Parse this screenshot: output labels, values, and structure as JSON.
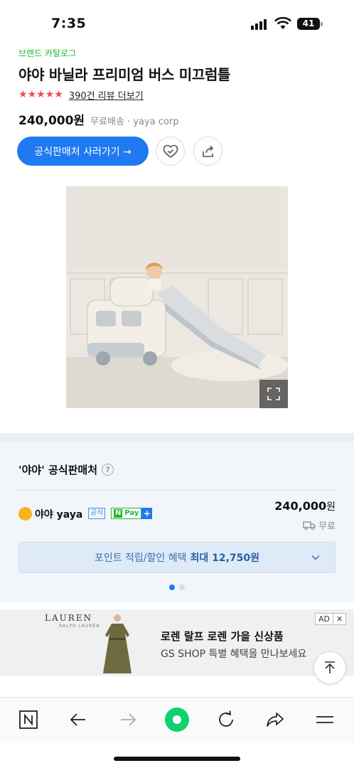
{
  "status_bar": {
    "time": "7:35",
    "battery": "41"
  },
  "product": {
    "brand_link": "브랜드 카탈로그",
    "title": "야야 바닐라 프리미엄 버스 미끄럼틀",
    "rating_stars": 5,
    "review_link": "390건 리뷰 더보기",
    "price": "240,000원",
    "shipping_info": "무료배송 · yaya corp",
    "buy_button": "공식판매처 사러가기 →"
  },
  "icons": {
    "wishlist": "heart-check-icon",
    "share": "share-icon",
    "expand": "expand-icon"
  },
  "seller_section": {
    "heading": "'야야' 공식판매처",
    "help": "?",
    "seller_name": "야야 yaya",
    "badge_official": "공식",
    "badge_npay_n": "N",
    "badge_npay": "Pay",
    "badge_npay_plus": "+",
    "price_number": "240,000",
    "price_unit": "원",
    "shipping": "무료",
    "benefit_text": "포인트 적립/할인 혜택",
    "benefit_highlight": "최대 12,750원",
    "pager_total": 2,
    "pager_active": 1
  },
  "ad": {
    "brand": "LAUREN",
    "brand_sub": "RALPH LAUREN",
    "title": "로렌 랄프 로렌 가을 신상품",
    "subtitle": "GS SHOP 특별 혜택을 만나보세요",
    "ad_label": "AD",
    "close_label": "✕"
  },
  "colors": {
    "brand_green": "#1fb830",
    "primary_blue": "#1f7af1",
    "star_red": "#f04a4a",
    "section_bg": "#f2f6fa"
  },
  "bottom_nav": [
    "naver-icon",
    "back-arrow-icon",
    "forward-arrow-icon",
    "green-dot-icon",
    "reload-icon",
    "share-arrow-icon",
    "menu-icon"
  ]
}
